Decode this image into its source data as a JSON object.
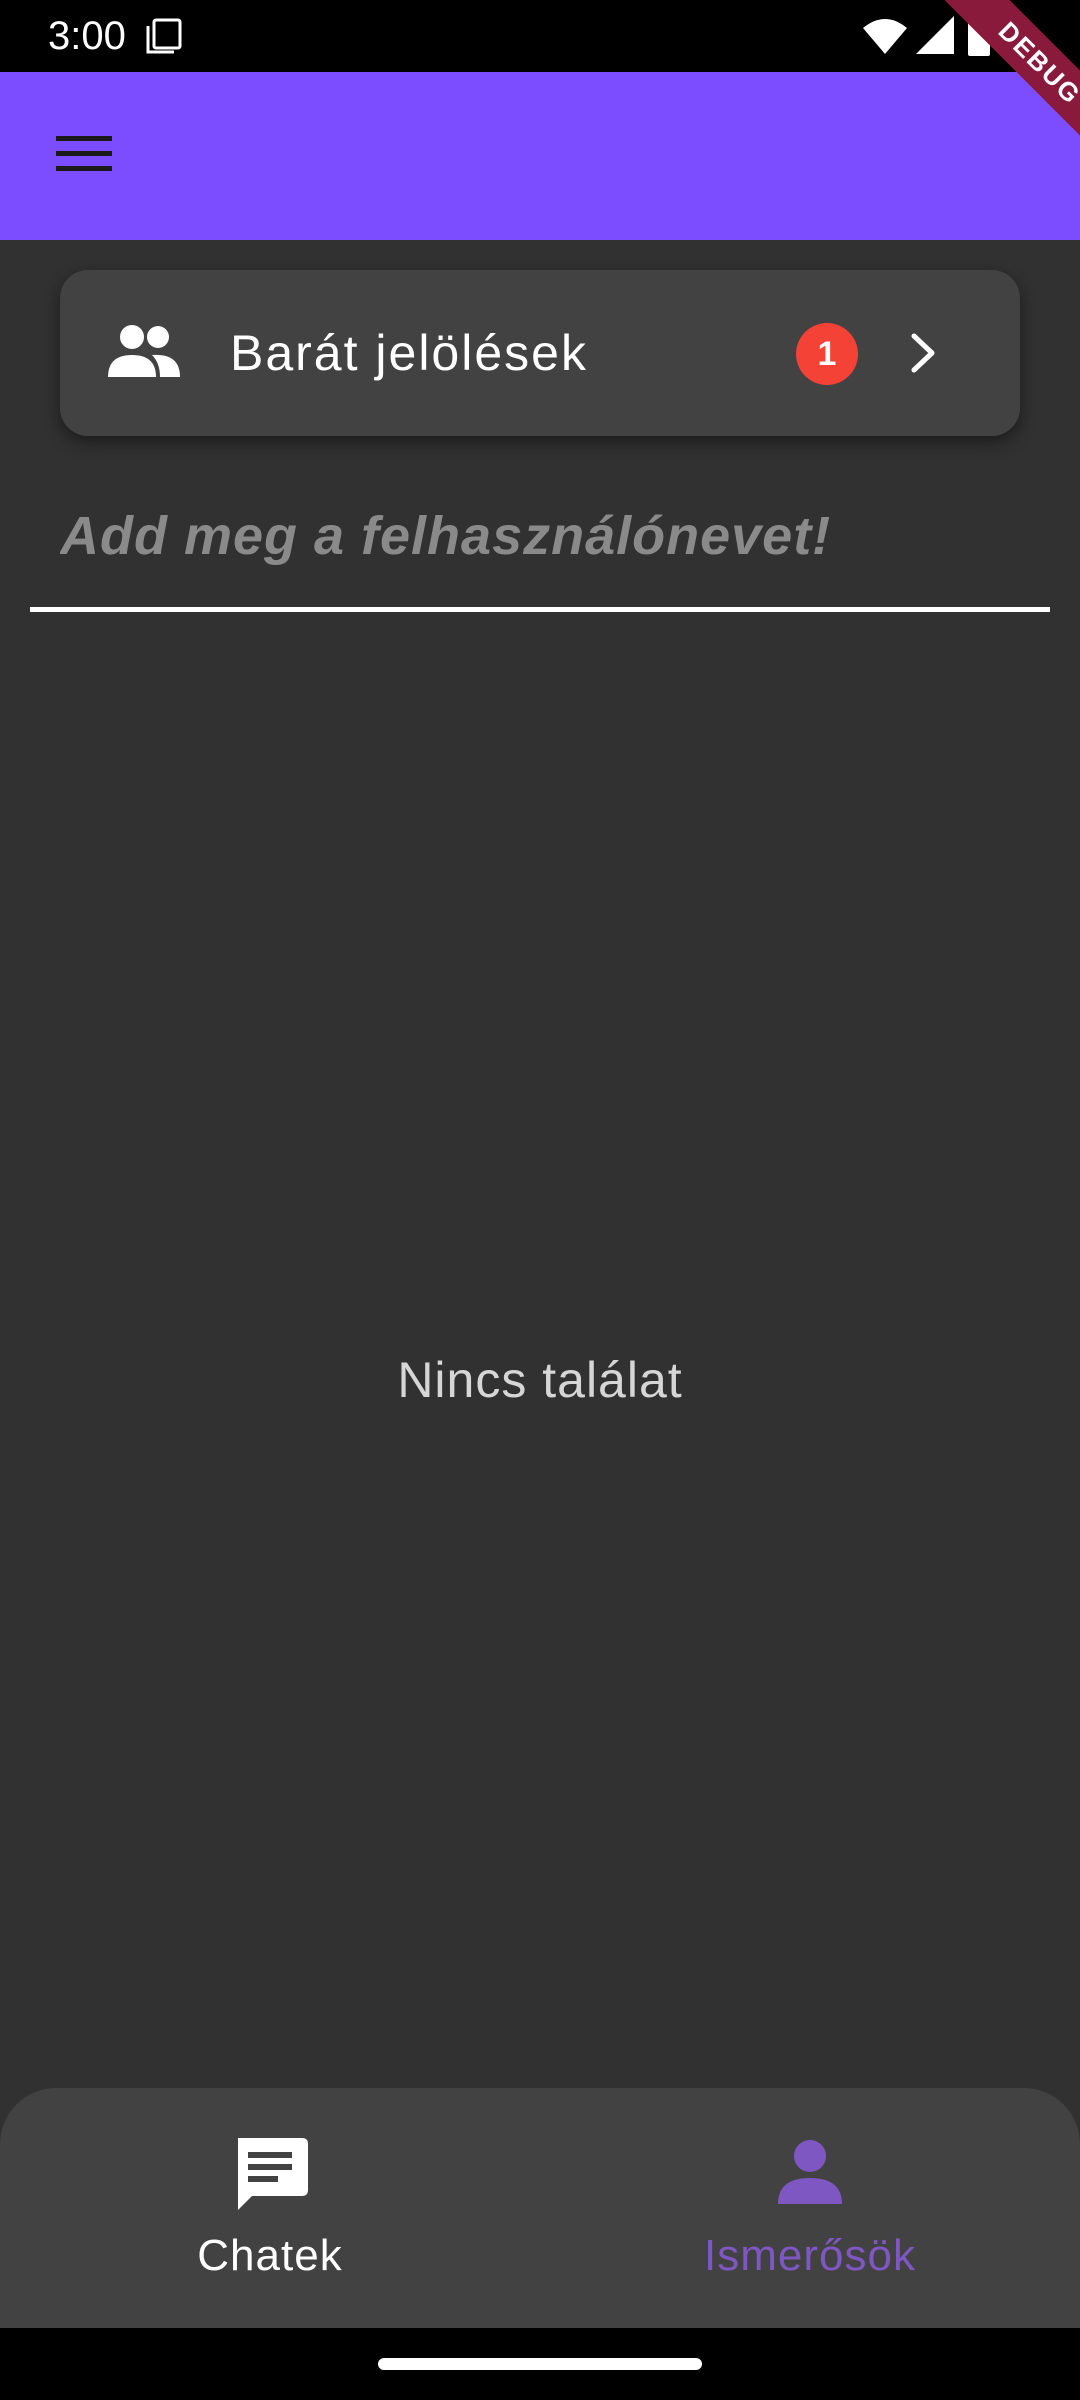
{
  "status_bar": {
    "time": "3:00",
    "icons": [
      "sim-card-icon",
      "wifi-icon",
      "signal-icon",
      "battery-icon"
    ]
  },
  "debug_banner": {
    "label": "DEBUG",
    "color": "#8a1a3c"
  },
  "app_bar": {
    "color": "#7c4dff",
    "menu_icon": "hamburger-menu-icon"
  },
  "friend_requests": {
    "label": "Barát jelölések",
    "badge_count": "1",
    "icon": "people-icon",
    "trailing_icon": "chevron-right-icon",
    "badge_color": "#f44336"
  },
  "search": {
    "value": "",
    "placeholder": "Add meg a felhasználónevet!"
  },
  "empty_state": {
    "message": "Nincs találat"
  },
  "bottom_nav": {
    "items": [
      {
        "label": "Chatek",
        "icon": "chat-icon",
        "selected": false,
        "color": "#ffffff"
      },
      {
        "label": "Ismerősök",
        "icon": "person-icon",
        "selected": true,
        "color": "#7e57c2"
      }
    ]
  },
  "colors": {
    "background": "#313131",
    "surface": "#424242",
    "accent": "#7c4dff"
  }
}
